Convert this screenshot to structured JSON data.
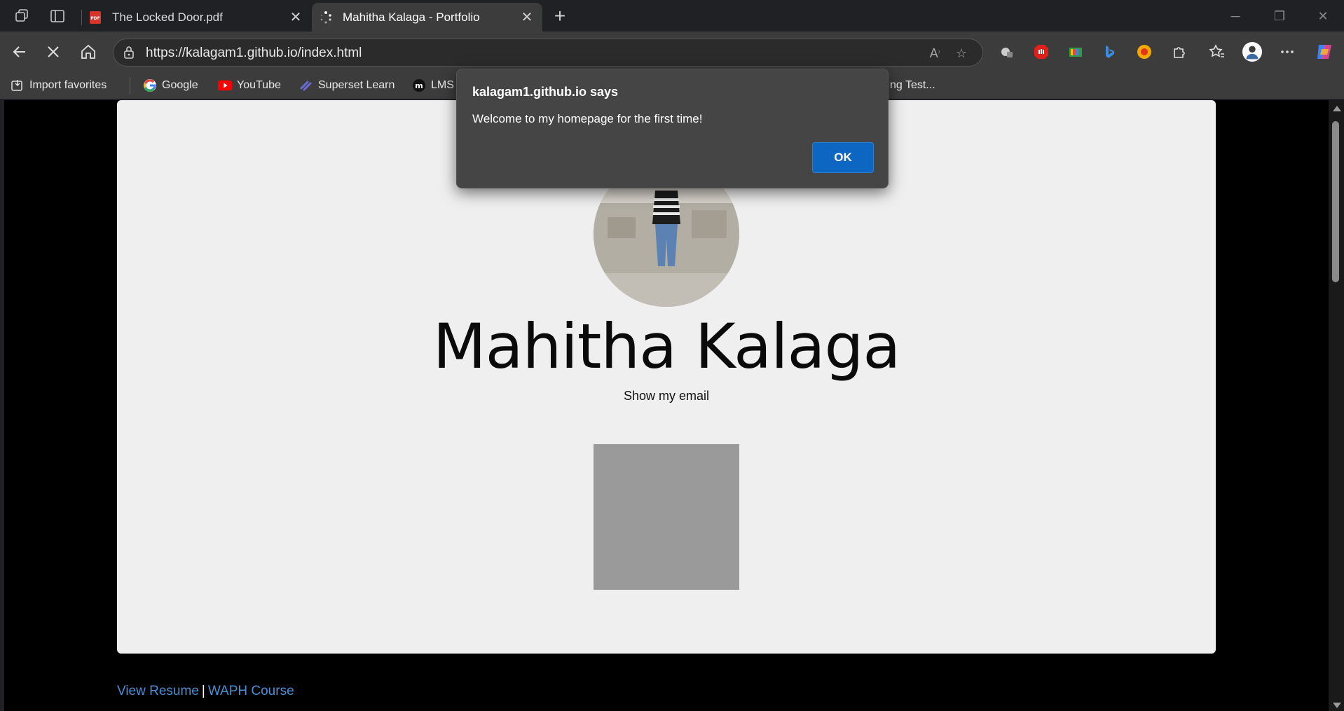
{
  "tabs": [
    {
      "title": "The Locked Door.pdf",
      "favicon": "pdf-icon",
      "active": false
    },
    {
      "title": "Mahitha Kalaga - Portfolio",
      "favicon": "loading-spinner-icon",
      "active": true
    }
  ],
  "toolbar": {
    "url": "https://kalagam1.github.io/index.html"
  },
  "bookmarks": [
    {
      "label": "Import favorites",
      "icon": "import-icon"
    },
    {
      "label": "Google",
      "icon": "google-icon"
    },
    {
      "label": "YouTube",
      "icon": "youtube-icon"
    },
    {
      "label": "Superset Learn",
      "icon": "superset-icon"
    },
    {
      "label": "LMS",
      "icon": "lms-icon"
    },
    {
      "label": "ng Test...",
      "icon": ""
    }
  ],
  "page": {
    "name": "Mahitha Kalaga",
    "email_link": "Show my email",
    "footer": {
      "resume_link": "View Resume",
      "separator": "|",
      "course_link": "WAPH Course"
    }
  },
  "dialog": {
    "title": "kalagam1.github.io says",
    "message": "Welcome to my homepage for the first time!",
    "ok_label": "OK"
  },
  "colors": {
    "link": "#4a8fd6",
    "ok_button": "#0c66c2",
    "card_bg": "#efefef"
  }
}
